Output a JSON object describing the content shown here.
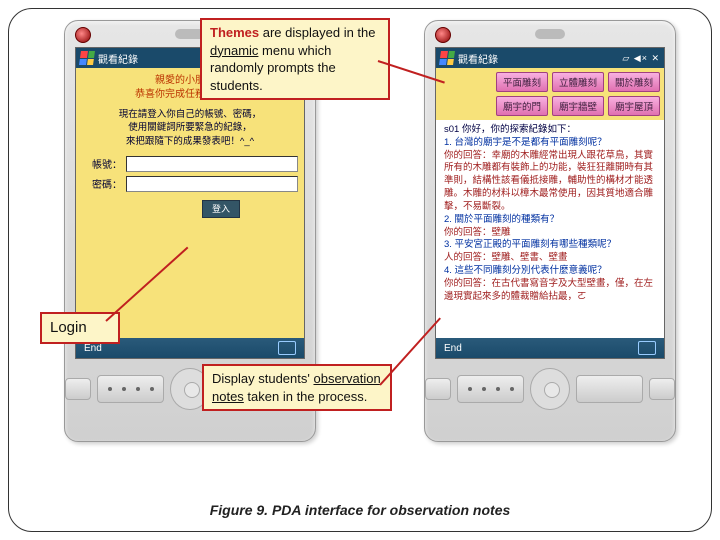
{
  "taskbar": {
    "title": "觀看紀錄",
    "sysicons": "▱ ◀× ✕"
  },
  "softbar": {
    "end": "End"
  },
  "left_screen": {
    "greet_l1": "親愛的小朋友～",
    "greet_l2": "恭喜你完成任務的探索！",
    "instr_l1": "現在請登入你自己的帳號、密碼，",
    "instr_l2": "使用關鍵詞所要緊急的紀錄，",
    "instr_l3": "來把跟隨下的成果發表吧！^_^",
    "label_user": "帳號：",
    "label_pass": "密碼：",
    "login_btn": "登入"
  },
  "right_screen": {
    "tabs_row1": [
      "平面雕刻",
      "立體雕刻",
      "關於雕刻"
    ],
    "tabs_row2": [
      "廟宇的門",
      "廟宇牆壁",
      "廟宇屋頂"
    ],
    "notes_lead": "s01 你好，你的探索紀錄如下：",
    "notes": [
      {
        "q": "1. 台灣的廟宇是不是都有平面雕刻呢？",
        "a": "你的回答：幸廟的木雕經常出現人跟花草鳥，其實所有的木雕都有裝飾上的功能，裝狂狂離開時有其準則，結構性該看儀抵接雕，輔助性的構材才能透雕。木雕的材料以樟木最常使用，因其質地適合雕擊，不易斷裂。"
      },
      {
        "q": "2. 關於平面雕刻的種類有？",
        "a": "你的回答：壁雕"
      },
      {
        "q": "3. 平安宮正殿的平面雕刻有哪些種類呢？",
        "a": "人的回答：壁雕、壁書、壁畫"
      },
      {
        "q": "4. 這些不同雕刻分別代表什麼意義呢？",
        "a": "你的回答：在古代書寫音字及大型壁畫，僅，在左邊現實起來多的體裁贈給拈最，ㄛ"
      }
    ]
  },
  "callouts": {
    "themes_word": "Themes",
    "themes_rest1": " are displayed in the ",
    "themes_dyn": "dynamic",
    "themes_rest2": " menu which randomly prompts the students.",
    "login": "Login",
    "observe_l1": "Display students' ",
    "observe_key": "observation notes",
    "observe_l2": " taken in the process."
  },
  "caption": "Figure 9. PDA interface for observation notes"
}
